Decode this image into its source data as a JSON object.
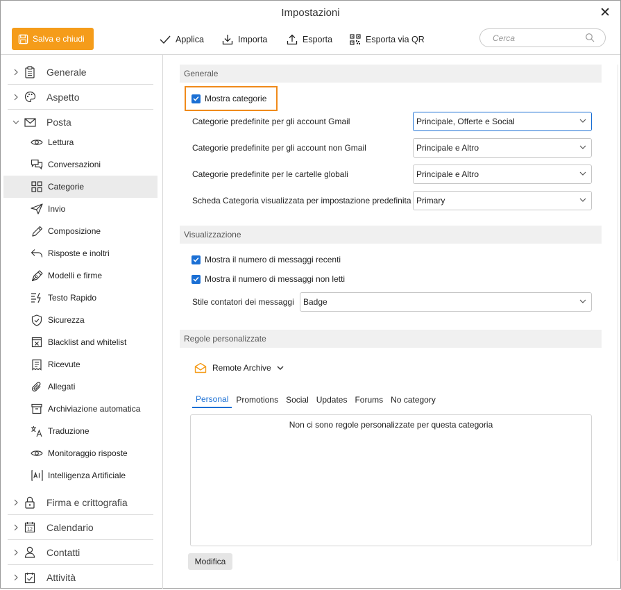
{
  "window": {
    "title": "Impostazioni"
  },
  "toolbar": {
    "save_label": "Salva e chiudi",
    "apply_label": "Applica",
    "import_label": "Importa",
    "export_label": "Esporta",
    "export_qr_label": "Esporta via QR",
    "search_placeholder": "Cerca"
  },
  "sidebar": {
    "sections_top": [
      {
        "label": "Generale",
        "icon": "clipboard-icon"
      },
      {
        "label": "Aspetto",
        "icon": "palette-icon"
      },
      {
        "label": "Posta",
        "icon": "mail-icon"
      }
    ],
    "items": [
      {
        "label": "Lettura",
        "icon": "eye-icon"
      },
      {
        "label": "Conversazioni",
        "icon": "conversation-icon"
      },
      {
        "label": "Categorie",
        "icon": "grid-icon",
        "selected": true
      },
      {
        "label": "Invio",
        "icon": "send-icon"
      },
      {
        "label": "Composizione",
        "icon": "pencil-icon"
      },
      {
        "label": "Risposte e inoltri",
        "icon": "reply-icon"
      },
      {
        "label": "Modelli e firme",
        "icon": "pen-nib-icon"
      },
      {
        "label": "Testo Rapido",
        "icon": "quick-text-icon"
      },
      {
        "label": "Sicurezza",
        "icon": "shield-icon"
      },
      {
        "label": "Blacklist and whitelist",
        "icon": "block-list-icon"
      },
      {
        "label": "Ricevute",
        "icon": "receipt-icon"
      },
      {
        "label": "Allegati",
        "icon": "paperclip-icon"
      },
      {
        "label": "Archiviazione automatica",
        "icon": "archive-icon"
      },
      {
        "label": "Traduzione",
        "icon": "translate-icon"
      },
      {
        "label": "Monitoraggio risposte",
        "icon": "eye-icon"
      },
      {
        "label": "Intelligenza Artificiale",
        "icon": "ai-icon"
      }
    ],
    "sections_bottom": [
      {
        "label": "Firma e crittografia",
        "icon": "lock-icon"
      },
      {
        "label": "Calendario",
        "icon": "calendar-icon",
        "calendar_day": "12"
      },
      {
        "label": "Contatti",
        "icon": "person-icon"
      },
      {
        "label": "Attività",
        "icon": "task-icon"
      }
    ]
  },
  "main": {
    "general": {
      "header": "Generale",
      "show_categories": {
        "label": "Mostra categorie",
        "checked": true
      },
      "rows": [
        {
          "label": "Categorie predefinite per gli account Gmail",
          "value": "Principale, Offerte e Social"
        },
        {
          "label": "Categorie predefinite per gli account non Gmail",
          "value": "Principale e Altro"
        },
        {
          "label": "Categorie predefinite per le cartelle globali",
          "value": "Principale e Altro"
        },
        {
          "label": "Scheda Categoria visualizzata per impostazione predefinita",
          "value": "Primary"
        }
      ]
    },
    "display": {
      "header": "Visualizzazione",
      "checkboxes": [
        {
          "label": "Mostra il numero di messaggi recenti",
          "checked": true
        },
        {
          "label": "Mostra il numero di messaggi non letti",
          "checked": true
        }
      ],
      "counter_style_label": "Stile contatori dei messaggi",
      "counter_style_value": "Badge"
    },
    "custom_rules": {
      "header": "Regole personalizzate",
      "account": "Remote Archive",
      "tabs": [
        "Personal",
        "Promotions",
        "Social",
        "Updates",
        "Forums",
        "No category"
      ],
      "active_tab": "Personal",
      "empty_message": "Non ci sono regole personalizzate per questa categoria",
      "modify_label": "Modifica"
    }
  },
  "colors": {
    "accent": "#f59c1a",
    "highlight_border": "#f08a1a",
    "checkbox": "#1a6fd4"
  }
}
